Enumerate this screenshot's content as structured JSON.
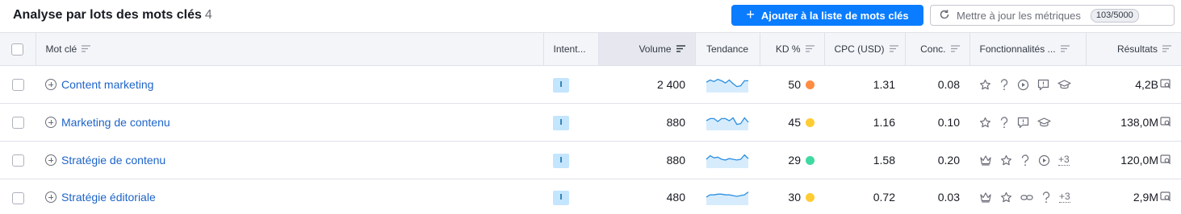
{
  "header": {
    "title": "Analyse par lots des mots clés",
    "count": "4",
    "add_button_label": "Ajouter à la liste de mots clés",
    "update_button_label": "Mettre à jour les métriques",
    "update_quota": "103/5000"
  },
  "columns": {
    "keyword": "Mot clé",
    "intent": "Intent...",
    "volume": "Volume",
    "trend": "Tendance",
    "kd": "KD %",
    "cpc": "CPC (USD)",
    "competition": "Conc.",
    "features": "Fonctionnalités ...",
    "results": "Résultats"
  },
  "rows": [
    {
      "keyword": "Content marketing",
      "intent": "I",
      "volume": "2 400",
      "trend": [
        0.6,
        0.75,
        0.65,
        0.8,
        0.7,
        0.55,
        0.75,
        0.5,
        0.3,
        0.35,
        0.7,
        0.7
      ],
      "kd": "50",
      "kd_color": "#ff8c43",
      "cpc": "1.31",
      "competition": "0.08",
      "features": [
        "star-icon",
        "question-icon",
        "video-icon",
        "review-icon",
        "academic-cap-icon"
      ],
      "more": "",
      "results": "4,2B"
    },
    {
      "keyword": "Marketing de contenu",
      "intent": "I",
      "volume": "880",
      "trend": [
        0.55,
        0.7,
        0.7,
        0.5,
        0.7,
        0.7,
        0.55,
        0.75,
        0.3,
        0.35,
        0.75,
        0.45
      ],
      "kd": "45",
      "kd_color": "#ffcc33",
      "cpc": "1.16",
      "competition": "0.10",
      "features": [
        "star-icon",
        "question-icon",
        "review-icon",
        "academic-cap-icon"
      ],
      "more": "",
      "results": "138,0M"
    },
    {
      "keyword": "Stratégie de contenu",
      "intent": "I",
      "volume": "880",
      "trend": [
        0.5,
        0.75,
        0.6,
        0.65,
        0.5,
        0.45,
        0.55,
        0.5,
        0.45,
        0.5,
        0.8,
        0.55
      ],
      "kd": "29",
      "kd_color": "#3fd9a2",
      "cpc": "1.58",
      "competition": "0.20",
      "features": [
        "crown-icon",
        "star-icon",
        "question-icon",
        "video-icon"
      ],
      "more": "+3",
      "results": "120,0M"
    },
    {
      "keyword": "Stratégie éditoriale",
      "intent": "I",
      "volume": "480",
      "trend": [
        0.45,
        0.6,
        0.6,
        0.65,
        0.65,
        0.6,
        0.6,
        0.55,
        0.5,
        0.55,
        0.6,
        0.8
      ],
      "kd": "30",
      "kd_color": "#ffcc33",
      "cpc": "0.72",
      "competition": "0.03",
      "features": [
        "crown-icon",
        "star-icon",
        "link-icon",
        "question-icon"
      ],
      "more": "+3",
      "results": "2,9M"
    }
  ]
}
